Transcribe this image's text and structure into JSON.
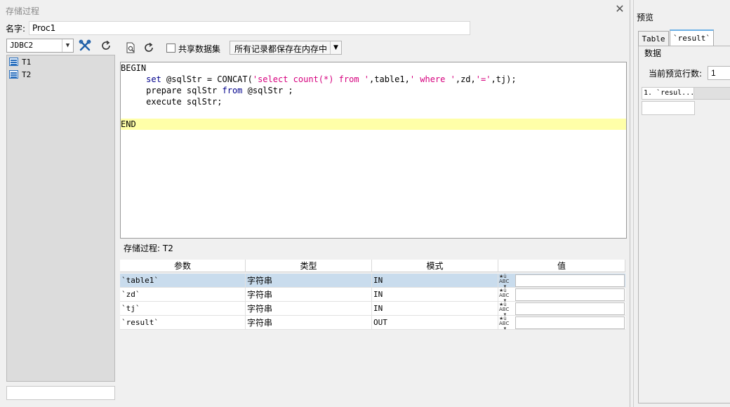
{
  "dialog": {
    "title": "存储过程",
    "name_label": "名字:",
    "name_value": "Proc1"
  },
  "left_panel": {
    "connection": "JDBC2",
    "tables": [
      "T1",
      "T2"
    ]
  },
  "editor_toolbar": {
    "share_label": "共享数据集",
    "memory_option": "所有记录都保存在内存中"
  },
  "code": {
    "line1": "BEGIN",
    "line2_a": "     set",
    "line2_b": " @sqlStr = CONCAT(",
    "line2_c": "'select count(*) from '",
    "line2_d": ",table1,",
    "line2_e": "' where '",
    "line2_f": ",zd,",
    "line2_g": "'='",
    "line2_h": ",tj);",
    "line3_a": "     prepare sqlStr ",
    "line3_b": "from",
    "line3_c": " @sqlStr ;",
    "line4": "     execute sqlStr;",
    "line6": "END"
  },
  "proc_label": "存储过程: T2",
  "params": {
    "headers": [
      "参数",
      "类型",
      "模式",
      "值"
    ],
    "rows": [
      {
        "name": "`table1`",
        "type": "字符串",
        "mode": "IN"
      },
      {
        "name": "`zd`",
        "type": "字符串",
        "mode": "IN"
      },
      {
        "name": "`tj`",
        "type": "字符串",
        "mode": "IN"
      },
      {
        "name": "`result`",
        "type": "字符串",
        "mode": "OUT"
      }
    ]
  },
  "preview": {
    "title": "预览",
    "tabs": [
      "Table",
      "`result`"
    ],
    "data_label": "数据",
    "rows_label": "当前预览行数:",
    "rows_value": "1",
    "column": "1. `resul..."
  }
}
